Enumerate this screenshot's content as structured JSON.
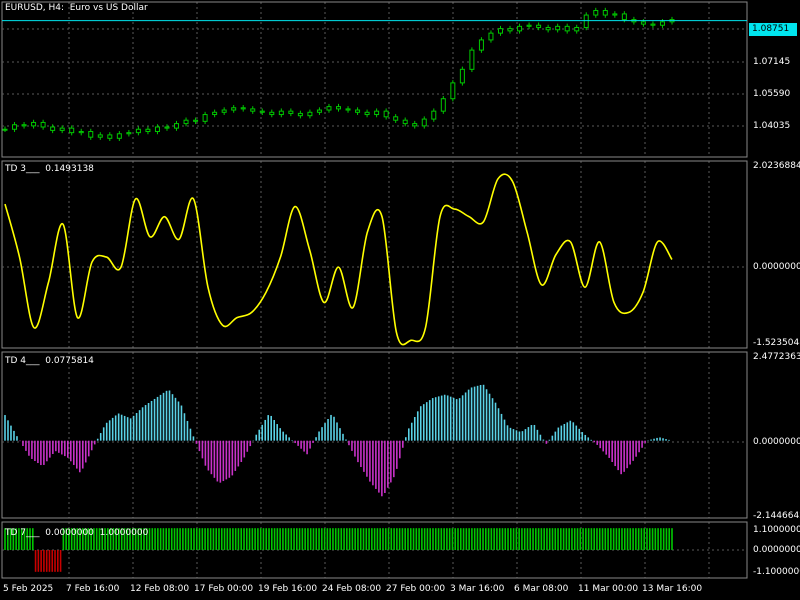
{
  "colors": {
    "background": "#000000",
    "candles": "#00c800",
    "oscillator_line": "#ffff00",
    "hist_positive": "#5ad2e6",
    "hist_negative": "#c832c8",
    "signal_up": "#00c800",
    "signal_down": "#c80000",
    "current_price": "#00e5ee",
    "grid": "#5a5a5a",
    "frame": "#888888"
  },
  "header": {
    "symbol_label": "EURUSD, H4:  Euro vs US Dollar",
    "current_price": "1.08751"
  },
  "price_scale": [
    "1.07145",
    "1.05590",
    "1.04035"
  ],
  "td3": {
    "label": "TD 3___  0.1493138",
    "scale": [
      "2.0236884",
      "0.0000000",
      "-1.5235048"
    ]
  },
  "td4": {
    "label": "TD 4___  0.0775814",
    "scale": [
      "2.4772363",
      "0.0000000",
      "-2.1446642"
    ]
  },
  "td7": {
    "label": "TD 7___  0.0000000  1.0000000",
    "scale": [
      "1.1000000",
      "0.0000000",
      "-1.1000000"
    ]
  },
  "time_axis": [
    "5 Feb 2025",
    "7 Feb 16:00",
    "12 Feb 08:00",
    "17 Feb 00:00",
    "19 Feb 16:00",
    "24 Feb 08:00",
    "27 Feb 00:00",
    "3 Mar 16:00",
    "6 Mar 08:00",
    "11 Mar 00:00",
    "13 Mar 16:00"
  ],
  "chart_data": [
    {
      "type": "candlestick",
      "title": "EURUSD, H4:  Euro vs US Dollar",
      "ylim": [
        1.029,
        1.094
      ],
      "close": [
        1.0395,
        1.0415,
        1.041,
        1.0425,
        1.0405,
        1.039,
        1.04,
        1.038,
        1.0385,
        1.036,
        1.037,
        1.0355,
        1.0375,
        1.038,
        1.0395,
        1.0385,
        1.0405,
        1.04,
        1.042,
        1.0435,
        1.043,
        1.046,
        1.047,
        1.048,
        1.049,
        1.0485,
        1.0475,
        1.047,
        1.046,
        1.0475,
        1.0465,
        1.0455,
        1.047,
        1.048,
        1.0495,
        1.0485,
        1.048,
        1.047,
        1.046,
        1.0475,
        1.045,
        1.0435,
        1.042,
        1.041,
        1.044,
        1.0475,
        1.053,
        1.06,
        1.066,
        1.0745,
        1.079,
        1.082,
        1.084,
        1.083,
        1.085,
        1.0855,
        1.0845,
        1.0835,
        1.085,
        1.083,
        1.0845,
        1.09,
        1.092,
        1.09,
        1.0905,
        1.088,
        1.087,
        1.086,
        1.0855,
        1.087,
        1.088
      ],
      "current": 1.08751
    },
    {
      "type": "line",
      "title": "TD 3___  0.1493138",
      "ylim": [
        -1.5235048,
        2.0236884
      ],
      "values": [
        1.25,
        0.2,
        -1.2,
        -0.3,
        0.85,
        -1.0,
        0.1,
        0.2,
        0.0,
        1.35,
        0.6,
        1.0,
        0.55,
        1.35,
        -0.4,
        -1.15,
        -1.0,
        -0.9,
        -0.5,
        0.2,
        1.2,
        0.35,
        -0.7,
        0.0,
        -0.8,
        0.7,
        1.0,
        -1.3,
        -1.45,
        -1.2,
        1.0,
        1.15,
        1.0,
        0.9,
        1.75,
        1.7,
        0.7,
        -0.35,
        0.25,
        0.5,
        -0.4,
        0.5,
        -0.7,
        -0.9,
        -0.5,
        0.5,
        0.15
      ],
      "last_value": 0.1493138
    },
    {
      "type": "bar",
      "title": "TD 4___  0.0775814",
      "ylim": [
        -2.1446642,
        2.4772363
      ],
      "values": [
        0.75,
        0.1,
        -0.5,
        -0.75,
        -0.3,
        -0.5,
        -0.95,
        -0.2,
        0.5,
        0.8,
        0.65,
        1.0,
        1.25,
        1.5,
        1.05,
        0.1,
        -0.8,
        -1.25,
        -1.05,
        -0.5,
        0.2,
        0.8,
        0.3,
        -0.05,
        -0.4,
        0.3,
        0.8,
        0.1,
        -0.6,
        -1.2,
        -1.65,
        -1.0,
        0.3,
        1.0,
        1.25,
        1.35,
        1.2,
        1.55,
        1.65,
        1.1,
        0.4,
        0.25,
        0.5,
        -0.1,
        0.4,
        0.6,
        0.2,
        -0.1,
        -0.5,
        -1.0,
        -0.55,
        0.0,
        0.1,
        0.0
      ],
      "last_value": 0.0775814
    },
    {
      "type": "bar",
      "title": "TD 7___  0.0000000  1.0000000",
      "ylim": [
        -1.1,
        1.1
      ],
      "values": [
        1,
        1,
        1,
        1,
        1,
        1,
        1,
        1,
        1,
        1,
        1,
        -1,
        -1,
        -1,
        -1,
        -1,
        -1,
        -1,
        -1,
        -1,
        -1,
        1,
        1,
        1,
        1,
        1,
        1,
        1,
        1,
        1,
        1,
        1,
        1,
        1,
        1,
        1,
        1,
        1,
        1,
        1,
        1,
        1,
        1,
        1,
        1,
        1,
        1,
        1,
        1,
        1,
        1,
        1,
        1,
        1,
        1,
        1,
        1,
        1,
        1,
        1,
        1,
        1,
        1,
        1,
        1,
        1,
        1,
        1,
        1,
        1,
        1,
        1,
        1,
        1,
        1,
        1,
        1,
        1,
        1,
        1,
        1,
        1,
        1,
        1,
        1,
        1,
        1,
        1,
        1,
        1,
        1,
        1,
        1,
        1,
        1,
        1,
        1,
        1,
        1,
        1,
        1,
        1,
        1,
        1,
        1,
        1,
        1,
        1,
        1,
        1,
        1,
        1,
        1,
        1,
        1,
        1,
        1,
        1,
        1,
        1,
        1,
        1,
        1,
        1,
        1,
        1,
        1,
        1,
        1,
        1,
        1,
        1,
        1,
        1,
        1,
        1,
        1,
        1,
        1,
        1,
        1,
        1,
        1,
        1,
        1,
        1,
        1,
        1,
        1,
        1,
        1,
        1,
        1,
        1,
        1,
        1,
        1,
        1,
        1,
        1,
        1,
        1,
        1,
        1,
        1,
        1,
        1,
        1,
        1,
        1,
        1,
        1,
        1,
        1,
        1,
        1,
        1,
        1,
        1,
        1,
        1,
        1,
        1,
        1,
        1,
        1,
        1,
        1,
        1,
        1,
        1,
        1,
        1,
        1,
        1,
        1,
        1,
        1,
        1,
        1,
        1,
        1,
        1,
        1,
        1,
        1,
        1,
        1,
        1,
        1,
        1,
        1,
        1,
        1,
        1,
        1,
        1,
        1,
        1,
        1,
        1,
        1,
        1,
        1,
        1,
        1,
        1,
        1,
        1,
        1,
        1,
        1,
        1,
        1,
        1,
        1,
        1,
        1,
        1,
        1,
        1
      ]
    }
  ]
}
